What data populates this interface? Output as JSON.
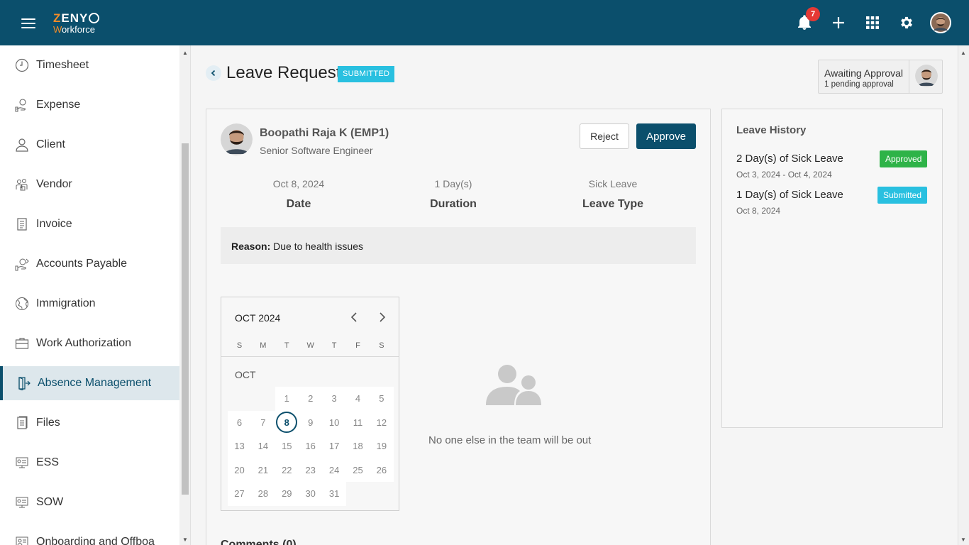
{
  "header": {
    "logo_line1_a": "Z",
    "logo_line1_b": "ENY",
    "logo_line2_a": "W",
    "logo_line2_b": "orkforce",
    "notification_count": "7"
  },
  "sidebar": {
    "items": [
      {
        "label": "Timesheet",
        "icon": "clock-icon"
      },
      {
        "label": "Expense",
        "icon": "money-hand-icon"
      },
      {
        "label": "Client",
        "icon": "user-icon"
      },
      {
        "label": "Vendor",
        "icon": "vendor-icon"
      },
      {
        "label": "Invoice",
        "icon": "invoice-icon"
      },
      {
        "label": "Accounts Payable",
        "icon": "payable-icon"
      },
      {
        "label": "Immigration",
        "icon": "globe-icon"
      },
      {
        "label": "Work Authorization",
        "icon": "briefcase-icon"
      },
      {
        "label": "Absence Management",
        "icon": "door-exit-icon",
        "active": true
      },
      {
        "label": "Files",
        "icon": "file-icon"
      },
      {
        "label": "ESS",
        "icon": "ess-icon"
      },
      {
        "label": "SOW",
        "icon": "sow-icon"
      },
      {
        "label": "Onboarding and Offboa",
        "icon": "onboarding-icon"
      }
    ]
  },
  "page": {
    "title": "Leave Request",
    "status": "SUBMITTED"
  },
  "awaiting": {
    "title": "Awaiting Approval",
    "subtitle": "1 pending approval"
  },
  "employee": {
    "name": "Boopathi Raja K (EMP1)",
    "role": "Senior Software Engineer"
  },
  "actions": {
    "reject": "Reject",
    "approve": "Approve"
  },
  "stats": [
    {
      "value": "Oct 8, 2024",
      "label": "Date"
    },
    {
      "value": "1 Day(s)",
      "label": "Duration"
    },
    {
      "value": "Sick Leave",
      "label": "Leave Type"
    }
  ],
  "reason": {
    "label": "Reason:",
    "text": "Due to health issues"
  },
  "calendar": {
    "title": "OCT 2024",
    "month_label": "OCT",
    "weekdays": [
      "S",
      "M",
      "T",
      "W",
      "T",
      "F",
      "S"
    ],
    "first_weekday": 2,
    "days": 31,
    "selected": 8
  },
  "empty_state": {
    "text": "No one else in the team will be out"
  },
  "comments": {
    "title": "Comments (0)"
  },
  "history": {
    "title": "Leave History",
    "items": [
      {
        "title": "2 Day(s) of Sick Leave",
        "dates": "Oct 3, 2024 - Oct 4, 2024",
        "status": "Approved",
        "color": "#2eb348"
      },
      {
        "title": "1 Day(s) of Sick Leave",
        "dates": "Oct 8, 2024",
        "status": "Submitted",
        "color": "#29c0e0"
      }
    ]
  },
  "colors": {
    "primary": "#0b4f6c",
    "accent": "#f28c28",
    "submitted": "#29c0e0",
    "approved": "#2eb348"
  }
}
